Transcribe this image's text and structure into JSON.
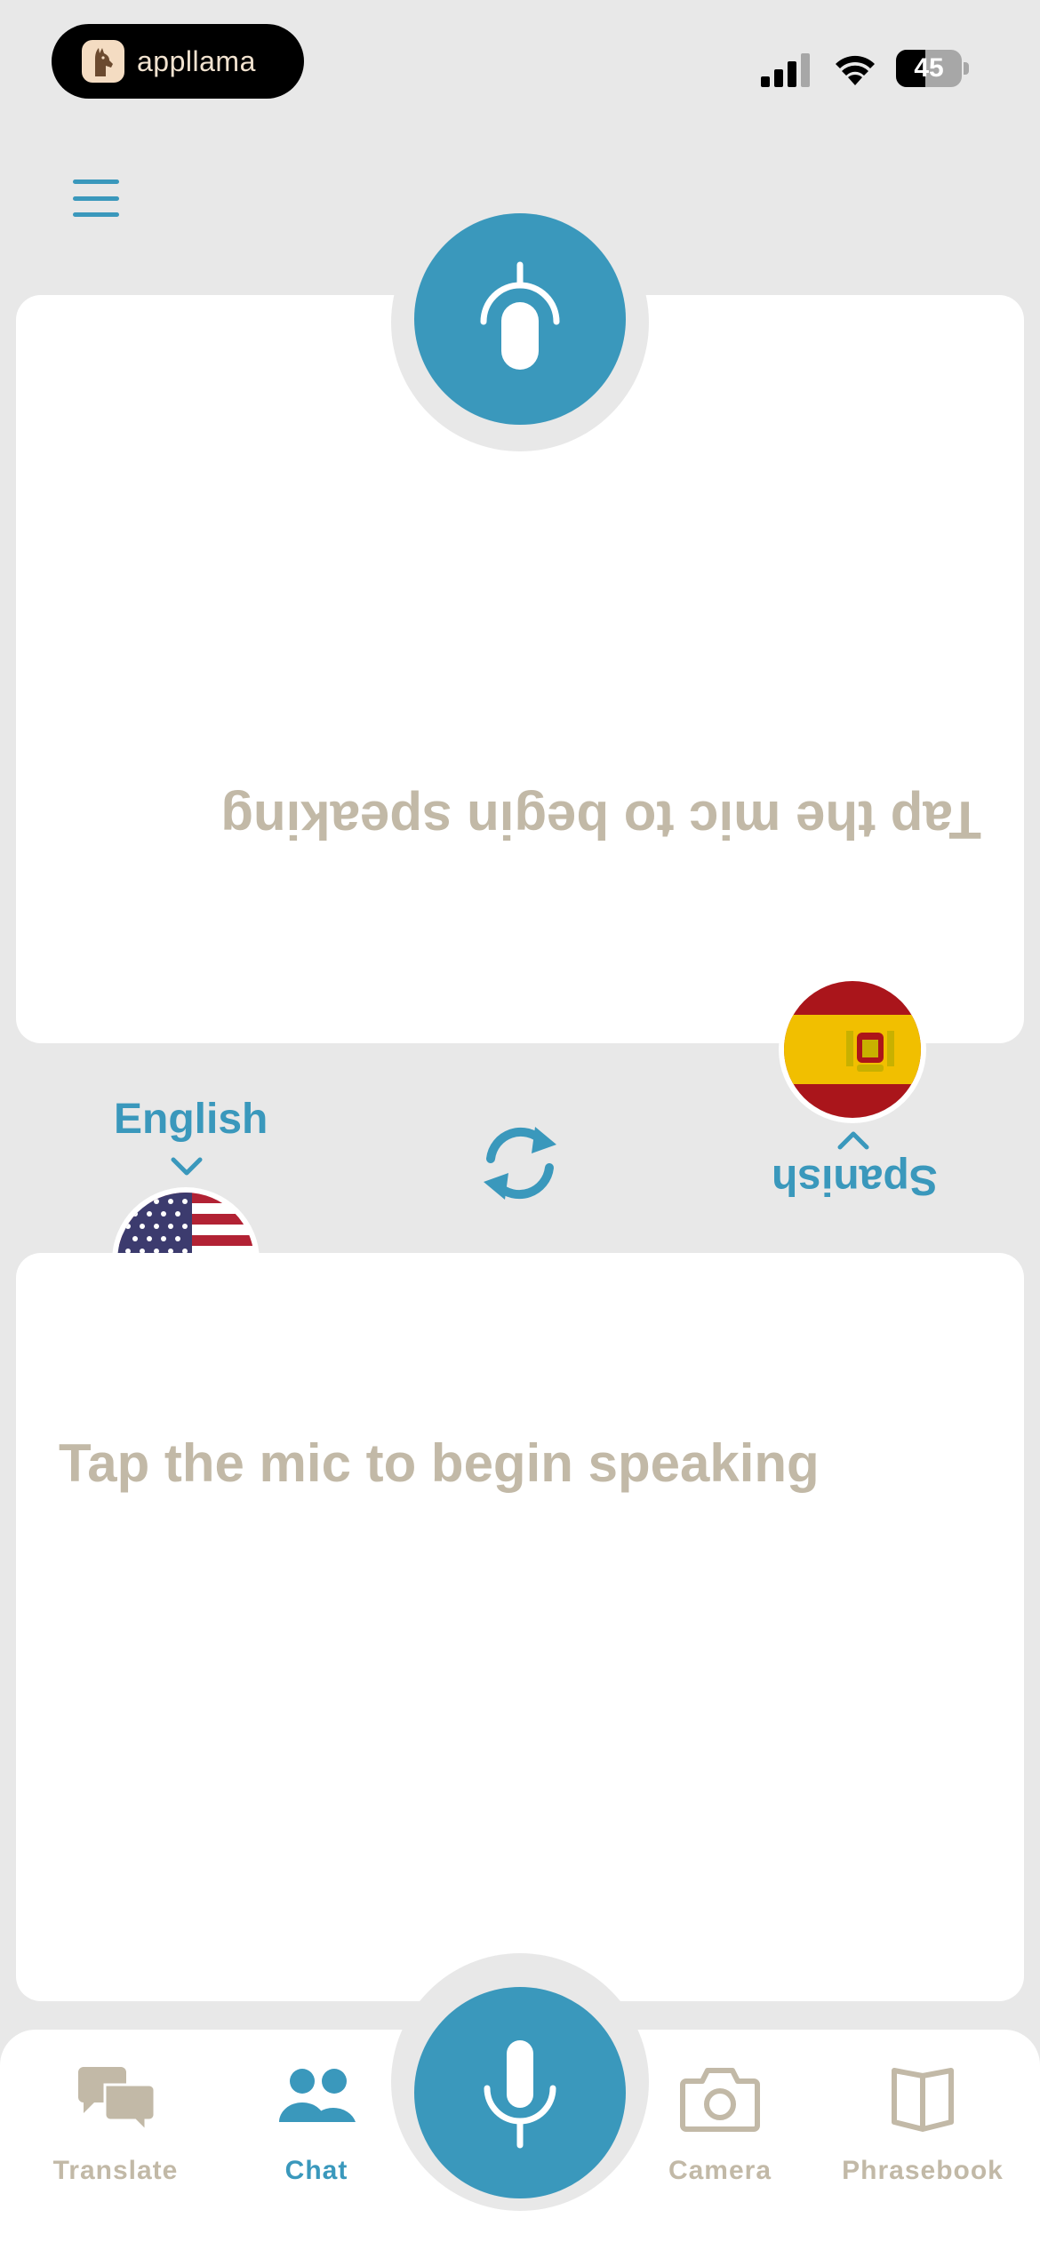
{
  "status_bar": {
    "app_name": "appllama",
    "battery_level": "45",
    "battery_fraction": 0.45
  },
  "top_panel": {
    "prompt": "Tap the mic to begin speaking",
    "language": "Spanish",
    "flag_icon": "spain-flag-icon"
  },
  "bottom_panel": {
    "prompt": "Tap the mic to begin speaking",
    "language": "English",
    "flag_icon": "us-flag-icon"
  },
  "tabs": [
    {
      "label": "Translate",
      "icon": "chat-bubbles-icon",
      "active": false
    },
    {
      "label": "Chat",
      "icon": "people-icon",
      "active": true
    },
    {
      "label": "Camera",
      "icon": "camera-icon",
      "active": false
    },
    {
      "label": "Phrasebook",
      "icon": "book-icon",
      "active": false
    }
  ],
  "colors": {
    "accent": "#3a98bc",
    "muted_text": "#c2b9a7",
    "background": "#e8e8e8",
    "card": "#ffffff"
  }
}
